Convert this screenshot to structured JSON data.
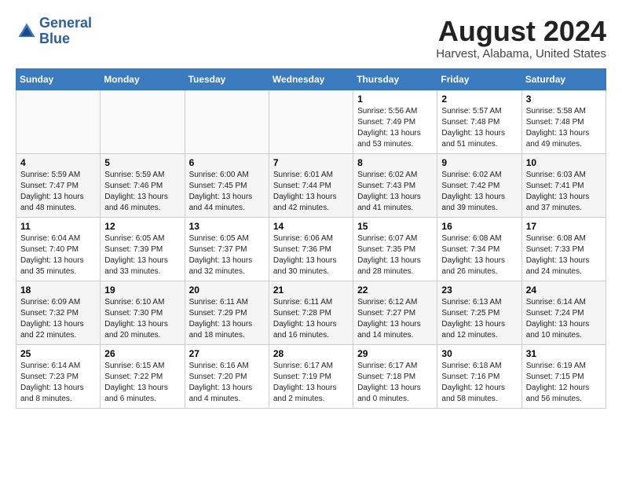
{
  "logo": {
    "line1": "General",
    "line2": "Blue"
  },
  "title": "August 2024",
  "location": "Harvest, Alabama, United States",
  "days_of_week": [
    "Sunday",
    "Monday",
    "Tuesday",
    "Wednesday",
    "Thursday",
    "Friday",
    "Saturday"
  ],
  "weeks": [
    [
      {
        "num": "",
        "info": ""
      },
      {
        "num": "",
        "info": ""
      },
      {
        "num": "",
        "info": ""
      },
      {
        "num": "",
        "info": ""
      },
      {
        "num": "1",
        "info": "Sunrise: 5:56 AM\nSunset: 7:49 PM\nDaylight: 13 hours\nand 53 minutes."
      },
      {
        "num": "2",
        "info": "Sunrise: 5:57 AM\nSunset: 7:48 PM\nDaylight: 13 hours\nand 51 minutes."
      },
      {
        "num": "3",
        "info": "Sunrise: 5:58 AM\nSunset: 7:48 PM\nDaylight: 13 hours\nand 49 minutes."
      }
    ],
    [
      {
        "num": "4",
        "info": "Sunrise: 5:59 AM\nSunset: 7:47 PM\nDaylight: 13 hours\nand 48 minutes."
      },
      {
        "num": "5",
        "info": "Sunrise: 5:59 AM\nSunset: 7:46 PM\nDaylight: 13 hours\nand 46 minutes."
      },
      {
        "num": "6",
        "info": "Sunrise: 6:00 AM\nSunset: 7:45 PM\nDaylight: 13 hours\nand 44 minutes."
      },
      {
        "num": "7",
        "info": "Sunrise: 6:01 AM\nSunset: 7:44 PM\nDaylight: 13 hours\nand 42 minutes."
      },
      {
        "num": "8",
        "info": "Sunrise: 6:02 AM\nSunset: 7:43 PM\nDaylight: 13 hours\nand 41 minutes."
      },
      {
        "num": "9",
        "info": "Sunrise: 6:02 AM\nSunset: 7:42 PM\nDaylight: 13 hours\nand 39 minutes."
      },
      {
        "num": "10",
        "info": "Sunrise: 6:03 AM\nSunset: 7:41 PM\nDaylight: 13 hours\nand 37 minutes."
      }
    ],
    [
      {
        "num": "11",
        "info": "Sunrise: 6:04 AM\nSunset: 7:40 PM\nDaylight: 13 hours\nand 35 minutes."
      },
      {
        "num": "12",
        "info": "Sunrise: 6:05 AM\nSunset: 7:39 PM\nDaylight: 13 hours\nand 33 minutes."
      },
      {
        "num": "13",
        "info": "Sunrise: 6:05 AM\nSunset: 7:37 PM\nDaylight: 13 hours\nand 32 minutes."
      },
      {
        "num": "14",
        "info": "Sunrise: 6:06 AM\nSunset: 7:36 PM\nDaylight: 13 hours\nand 30 minutes."
      },
      {
        "num": "15",
        "info": "Sunrise: 6:07 AM\nSunset: 7:35 PM\nDaylight: 13 hours\nand 28 minutes."
      },
      {
        "num": "16",
        "info": "Sunrise: 6:08 AM\nSunset: 7:34 PM\nDaylight: 13 hours\nand 26 minutes."
      },
      {
        "num": "17",
        "info": "Sunrise: 6:08 AM\nSunset: 7:33 PM\nDaylight: 13 hours\nand 24 minutes."
      }
    ],
    [
      {
        "num": "18",
        "info": "Sunrise: 6:09 AM\nSunset: 7:32 PM\nDaylight: 13 hours\nand 22 minutes."
      },
      {
        "num": "19",
        "info": "Sunrise: 6:10 AM\nSunset: 7:30 PM\nDaylight: 13 hours\nand 20 minutes."
      },
      {
        "num": "20",
        "info": "Sunrise: 6:11 AM\nSunset: 7:29 PM\nDaylight: 13 hours\nand 18 minutes."
      },
      {
        "num": "21",
        "info": "Sunrise: 6:11 AM\nSunset: 7:28 PM\nDaylight: 13 hours\nand 16 minutes."
      },
      {
        "num": "22",
        "info": "Sunrise: 6:12 AM\nSunset: 7:27 PM\nDaylight: 13 hours\nand 14 minutes."
      },
      {
        "num": "23",
        "info": "Sunrise: 6:13 AM\nSunset: 7:25 PM\nDaylight: 13 hours\nand 12 minutes."
      },
      {
        "num": "24",
        "info": "Sunrise: 6:14 AM\nSunset: 7:24 PM\nDaylight: 13 hours\nand 10 minutes."
      }
    ],
    [
      {
        "num": "25",
        "info": "Sunrise: 6:14 AM\nSunset: 7:23 PM\nDaylight: 13 hours\nand 8 minutes."
      },
      {
        "num": "26",
        "info": "Sunrise: 6:15 AM\nSunset: 7:22 PM\nDaylight: 13 hours\nand 6 minutes."
      },
      {
        "num": "27",
        "info": "Sunrise: 6:16 AM\nSunset: 7:20 PM\nDaylight: 13 hours\nand 4 minutes."
      },
      {
        "num": "28",
        "info": "Sunrise: 6:17 AM\nSunset: 7:19 PM\nDaylight: 13 hours\nand 2 minutes."
      },
      {
        "num": "29",
        "info": "Sunrise: 6:17 AM\nSunset: 7:18 PM\nDaylight: 13 hours\nand 0 minutes."
      },
      {
        "num": "30",
        "info": "Sunrise: 6:18 AM\nSunset: 7:16 PM\nDaylight: 12 hours\nand 58 minutes."
      },
      {
        "num": "31",
        "info": "Sunrise: 6:19 AM\nSunset: 7:15 PM\nDaylight: 12 hours\nand 56 minutes."
      }
    ]
  ]
}
